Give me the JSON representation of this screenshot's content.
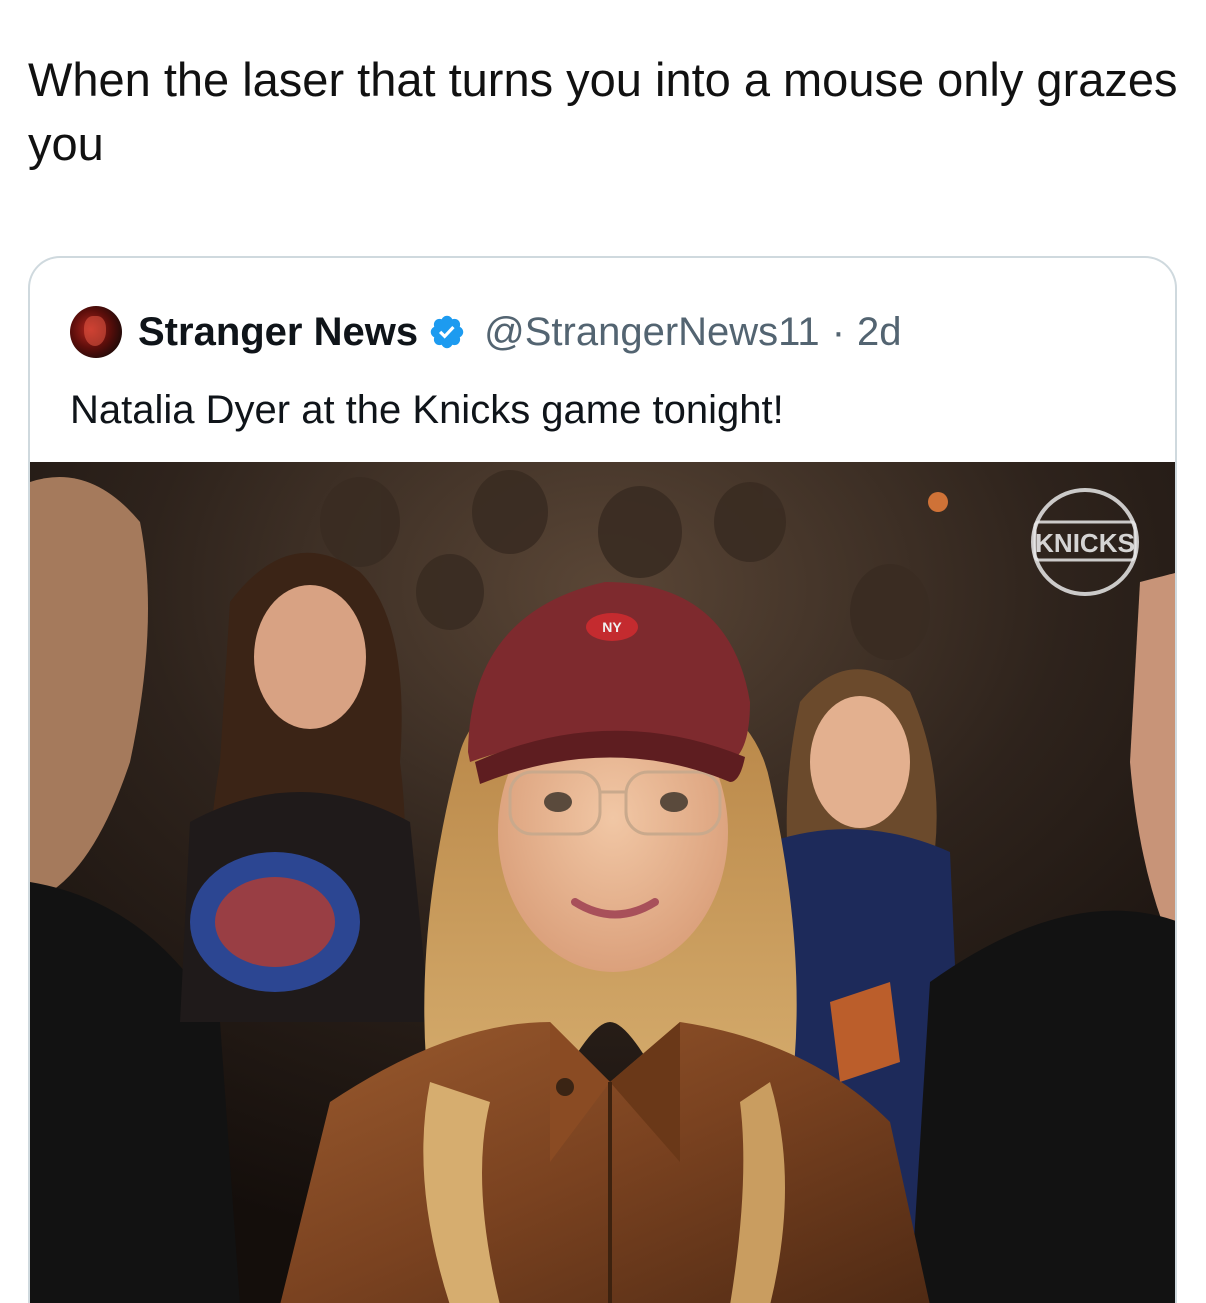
{
  "post": {
    "caption": "When the laser that turns you into a mouse only grazes you"
  },
  "quoted_tweet": {
    "display_name": "Stranger News",
    "verified": true,
    "handle": "@StrangerNews11",
    "separator": "·",
    "time": "2d",
    "text": "Natalia Dyer at the Knicks game tonight!",
    "avatar_icon": "avatar-icon",
    "verified_icon": "verified-badge-icon",
    "verified_color": "#1d9bf0",
    "photo": {
      "overlay_logo_text": "KNICKS"
    }
  },
  "colors": {
    "text_primary": "#0f1419",
    "text_secondary": "#536471",
    "card_border": "#cfd9de"
  }
}
